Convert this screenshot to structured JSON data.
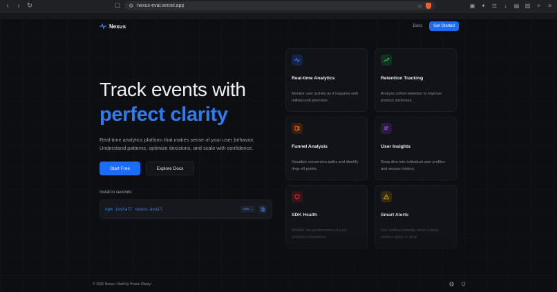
{
  "browser": {
    "url": "nexus-eval.vercel.app",
    "nav_back": "‹",
    "nav_forward": "›",
    "nav_reload": "↻"
  },
  "header": {
    "logo_text": "Nexus",
    "docs_label": "Docs",
    "get_started_label": "Get Started"
  },
  "hero": {
    "headline_line1": "Track events with",
    "headline_line2": "perfect clarity",
    "subtitle": "Real-time analytics platform that makes sense of your user behavior. Understand patterns, optimize decisions, and scale with confidence.",
    "start_free_label": "Start Free",
    "explore_docs_label": "Explore Docs",
    "install_label": "Install in seconds:",
    "install_command": "npm install nexus-avail",
    "package_manager": "npm ⌄"
  },
  "features": [
    {
      "title": "Real-time Analytics",
      "desc": "Monitor user activity as it happens with millisecond precision.",
      "icon": "activity-icon",
      "color": "#3c82f6"
    },
    {
      "title": "Retention Tracking",
      "desc": "Analyze cohort retention to improve product stickiness.",
      "icon": "trending-up-icon",
      "color": "#22c55e"
    },
    {
      "title": "Funnel Analysis",
      "desc": "Visualize conversion paths and identify drop-off points.",
      "icon": "funnel-icon",
      "color": "#f97316"
    },
    {
      "title": "User Insights",
      "desc": "Deep dive into individual user profiles and session history.",
      "icon": "users-icon",
      "color": "#a855f7"
    },
    {
      "title": "SDK Health",
      "desc": "Monitor the performance of your analytics integration.",
      "icon": "shield-icon",
      "color": "#ef4444"
    },
    {
      "title": "Smart Alerts",
      "desc": "Get notified instantly when critical metrics spike or drop.",
      "icon": "alert-icon",
      "color": "#eab308"
    }
  ],
  "footer": {
    "copyright": "© 2026 Nexus • Built by Praise Olaniyi"
  },
  "colors": {
    "accent": "#1a6ef5",
    "background": "#0c0e12"
  }
}
